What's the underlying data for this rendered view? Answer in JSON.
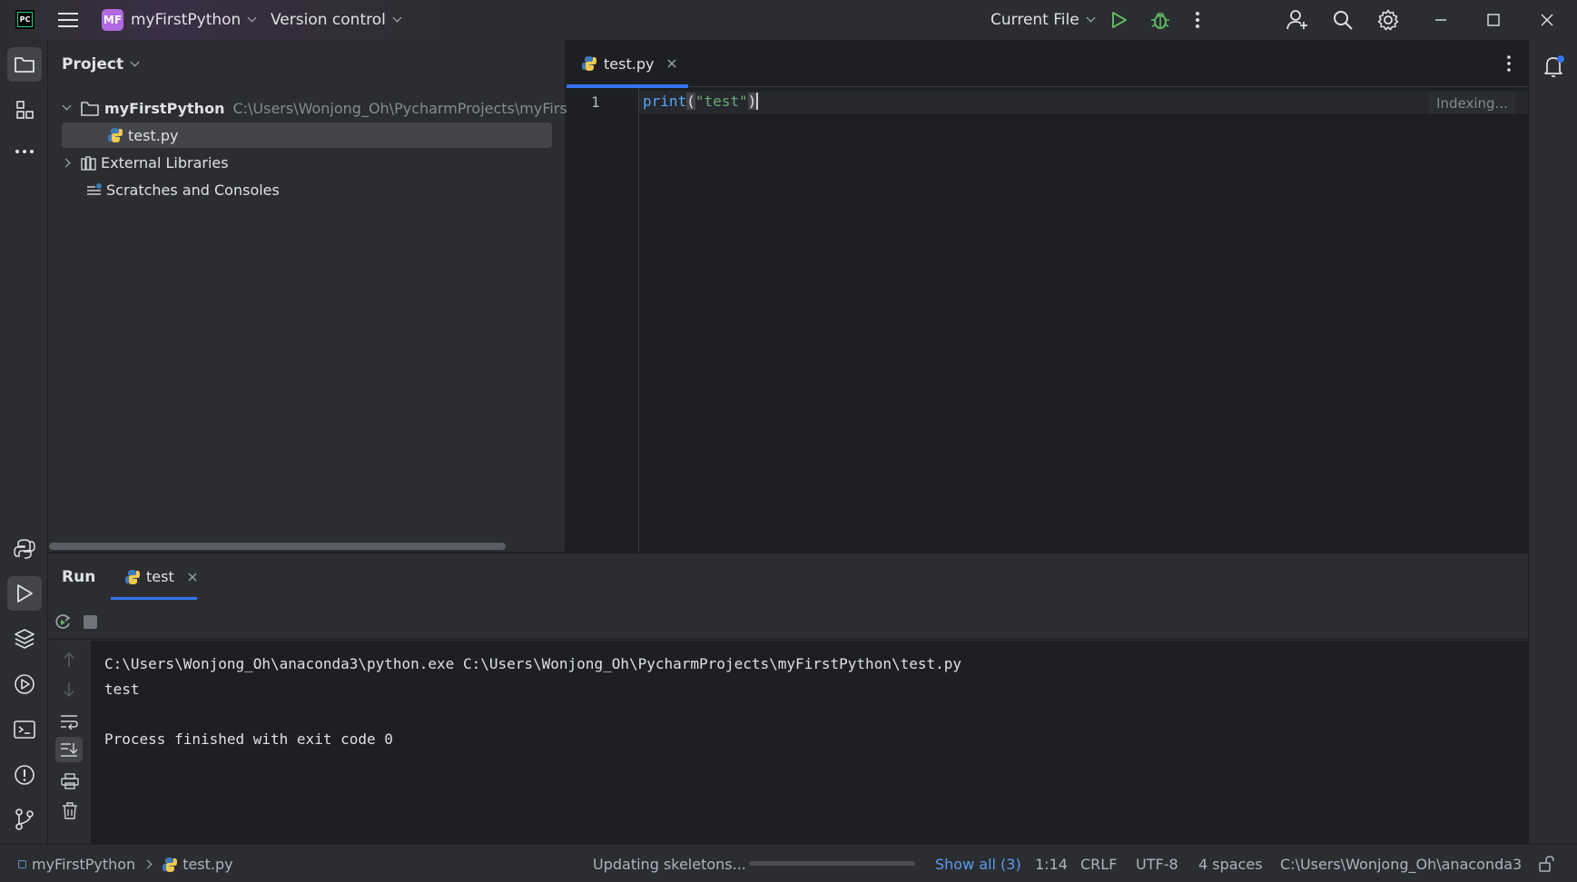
{
  "titlebar": {
    "project_badge": "MF",
    "project_name": "myFirstPython",
    "vcs_label": "Version control",
    "run_config": "Current File"
  },
  "toolstrip": {
    "icons": [
      "project-icon",
      "structure-icon",
      "more-icon",
      "python-console-icon",
      "run-icon",
      "layers-icon",
      "services-icon",
      "terminal-icon",
      "problems-icon",
      "git-icon"
    ]
  },
  "project_panel": {
    "title": "Project",
    "tree": [
      {
        "label": "myFirstPython",
        "path": "C:\\Users\\Wonjong_Oh\\PycharmProjects\\myFirst",
        "expanded": true
      },
      {
        "label": "test.py",
        "selected": true
      },
      {
        "label": "External Libraries",
        "expanded": false
      },
      {
        "label": "Scratches and Consoles"
      }
    ]
  },
  "editor": {
    "tab_label": "test.py",
    "line_number": "1",
    "code_fn": "print",
    "code_open": "(",
    "code_str": "\"test\"",
    "code_close": ")",
    "indexing": "Indexing..."
  },
  "run_panel": {
    "title": "Run",
    "tab_label": "test",
    "console_lines": [
      "C:\\Users\\Wonjong_Oh\\anaconda3\\python.exe C:\\Users\\Wonjong_Oh\\PycharmProjects\\myFirstPython\\test.py",
      "test",
      "",
      "Process finished with exit code 0"
    ]
  },
  "statusbar": {
    "breadcrumb_project": "myFirstPython",
    "breadcrumb_file": "test.py",
    "task": "Updating skeletons...",
    "task_progress": 0.0,
    "show_all": "Show all (3)",
    "position": "1:14",
    "line_sep": "CRLF",
    "encoding": "UTF-8",
    "indent": "4 spaces",
    "interpreter": "C:\\Users\\Wonjong_Oh\\anaconda3"
  },
  "colors": {
    "accent": "#3574f0",
    "keyword": "#56a8f5",
    "string": "#6aab73",
    "run_green": "#5fb865"
  }
}
